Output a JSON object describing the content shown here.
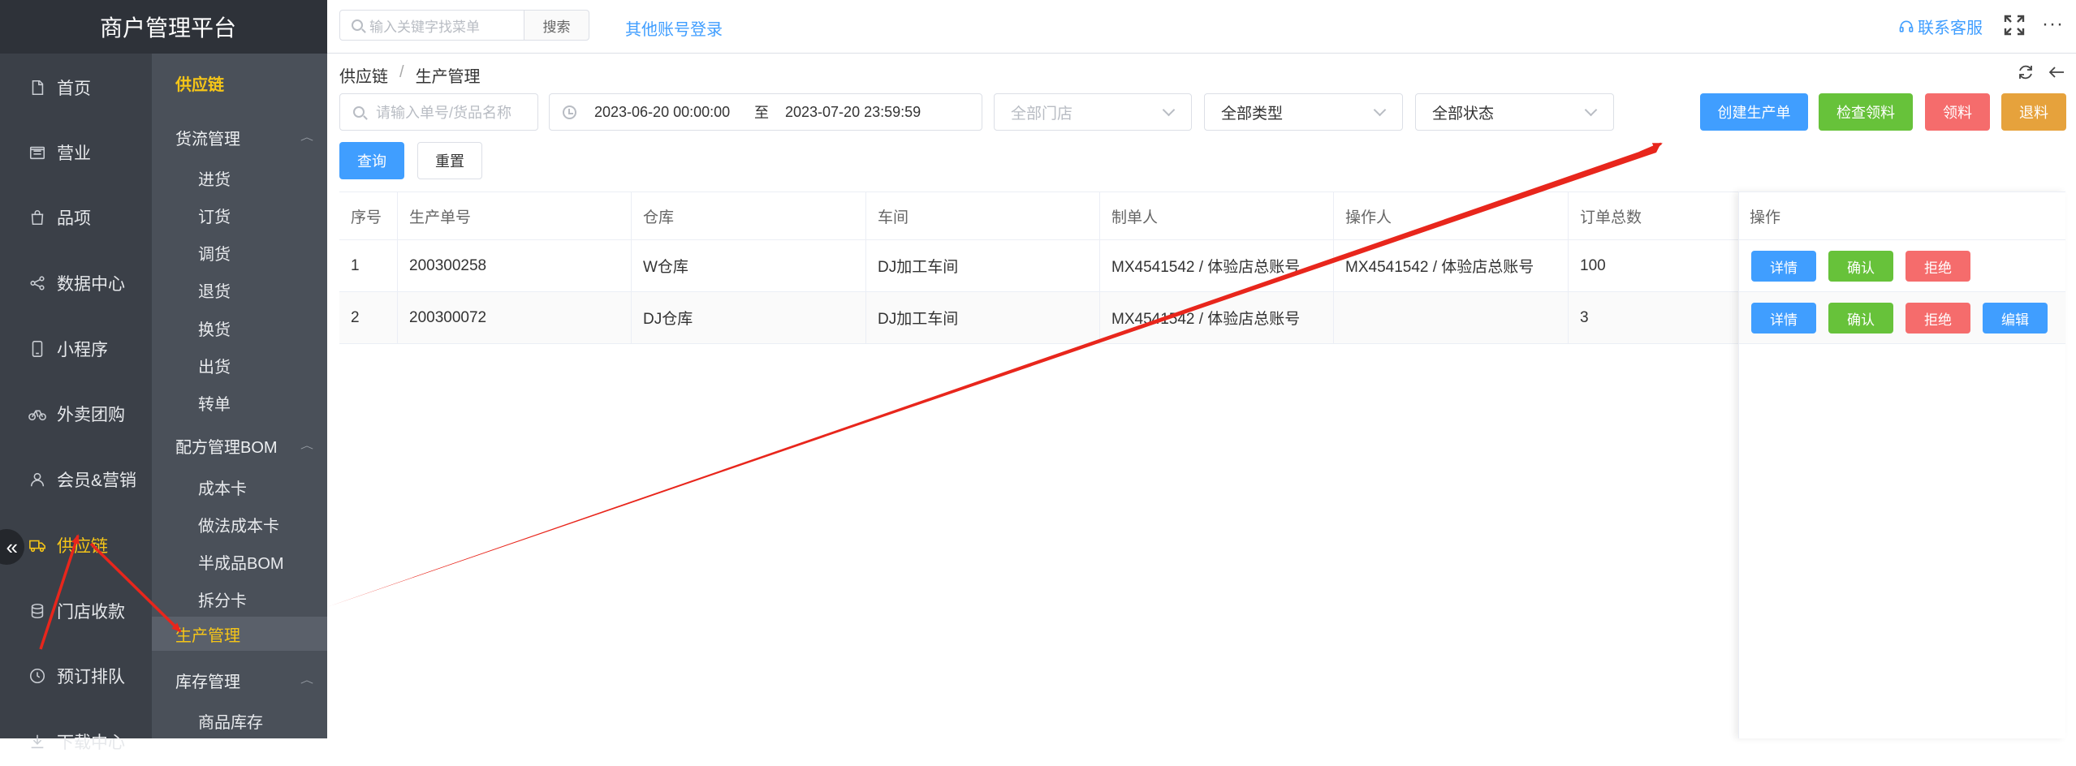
{
  "app": {
    "title": "商户管理平台"
  },
  "topbar": {
    "search_placeholder": "输入关键字找菜单",
    "search_button": "搜索",
    "other_login": "其他账号登录",
    "contact": "联系客服",
    "more": "···"
  },
  "sidebar": {
    "items": [
      {
        "label": "首页",
        "icon": "document-icon"
      },
      {
        "label": "营业",
        "icon": "register-icon"
      },
      {
        "label": "品项",
        "icon": "bag-icon"
      },
      {
        "label": "数据中心",
        "icon": "share-icon"
      },
      {
        "label": "小程序",
        "icon": "phone-icon"
      },
      {
        "label": "外卖团购",
        "icon": "bike-icon"
      },
      {
        "label": "会员&营销",
        "icon": "user-icon"
      },
      {
        "label": "供应链",
        "icon": "truck-icon",
        "active": true
      },
      {
        "label": "门店收款",
        "icon": "coins-icon"
      },
      {
        "label": "预订排队",
        "icon": "clock-icon"
      },
      {
        "label": "下载中心",
        "icon": "download-icon"
      }
    ],
    "collapse_glyph": "«"
  },
  "submenu": {
    "head": "供应链",
    "groups": [
      {
        "label": "货流管理",
        "items": [
          "进货",
          "订货",
          "调货",
          "退货",
          "换货",
          "出货",
          "转单"
        ]
      },
      {
        "label": "配方管理BOM",
        "items": [
          "成本卡",
          "做法成本卡",
          "半成品BOM",
          "拆分卡"
        ]
      },
      {
        "label": "库存管理",
        "items": [
          "商品库存"
        ]
      }
    ],
    "active": "生产管理"
  },
  "breadcrumb": [
    "供应链",
    "生产管理"
  ],
  "breadcrumb_sep": "/",
  "filters": {
    "keyword_placeholder": "请输入单号/货品名称",
    "date_start": "2023-06-20 00:00:00",
    "date_to": "至",
    "date_end": "2023-07-20 23:59:59",
    "store": "全部门店",
    "type": "全部类型",
    "status": "全部状态",
    "query": "查询",
    "reset": "重置"
  },
  "actions": {
    "create": "创建生产单",
    "check": "检查领料",
    "pick": "领料",
    "return": "退料"
  },
  "table": {
    "headers": [
      "序号",
      "生产单号",
      "仓库",
      "车间",
      "制单人",
      "操作人",
      "订单总数",
      "操作"
    ],
    "rows": [
      {
        "idx": "1",
        "no": "200300258",
        "warehouse": "W仓库",
        "workshop": "DJ加工车间",
        "maker": "MX4541542 / 体验店总账号",
        "operator": "MX4541542 / 体验店总账号",
        "total": "100",
        "ops": [
          "详情",
          "确认",
          "拒绝"
        ]
      },
      {
        "idx": "2",
        "no": "200300072",
        "warehouse": "DJ仓库",
        "workshop": "DJ加工车间",
        "maker": "MX4541542 / 体验店总账号",
        "operator": "",
        "total": "3",
        "ops": [
          "详情",
          "确认",
          "拒绝",
          "编辑"
        ]
      }
    ]
  },
  "colors": {
    "accent": "#409eff",
    "success": "#67c23a",
    "danger": "#f56c6c",
    "warning": "#e6a23c",
    "active_menu": "#f5c518",
    "annotation": "#e8261c"
  }
}
